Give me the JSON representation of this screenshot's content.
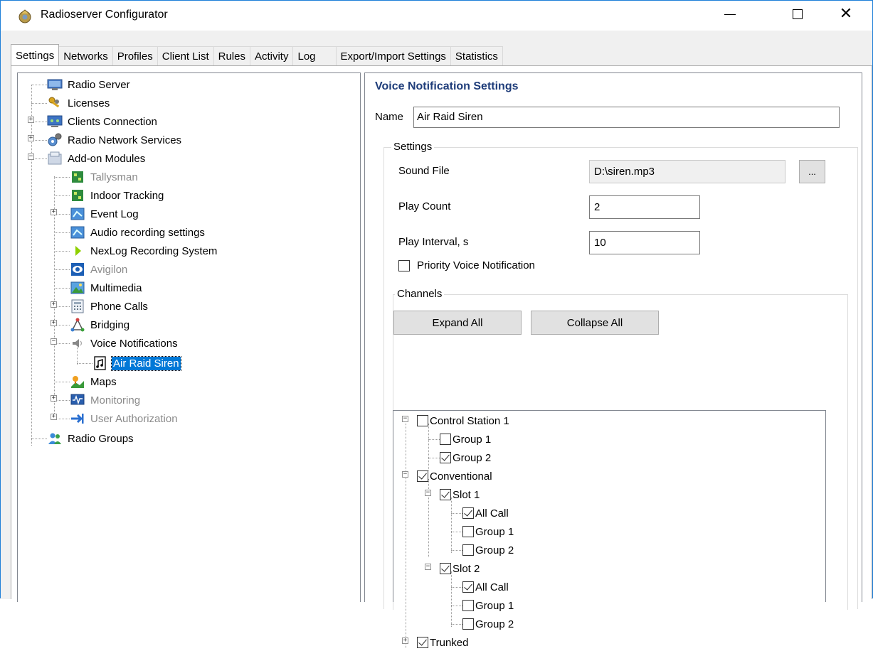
{
  "window": {
    "title": "Radioserver Configurator",
    "controls": {
      "minimize": "minimize",
      "maximize": "maximize",
      "close": "close"
    }
  },
  "tabs": [
    {
      "label": "Settings",
      "active": true
    },
    {
      "label": "Networks"
    },
    {
      "label": "Profiles"
    },
    {
      "label": "Client List"
    },
    {
      "label": "Rules"
    },
    {
      "label": "Activity"
    },
    {
      "label": "Log"
    },
    {
      "label": "Export/Import Settings"
    },
    {
      "label": "Statistics"
    }
  ],
  "tree": {
    "items": [
      {
        "label": "Radio Server",
        "icon": "server-icon"
      },
      {
        "label": "Licenses",
        "icon": "keys-icon"
      },
      {
        "label": "Clients Connection",
        "icon": "network-icon"
      },
      {
        "label": "Radio Network Services",
        "icon": "services-icon"
      },
      {
        "label": "Add-on Modules",
        "icon": "modules-icon"
      },
      {
        "label": "Tallysman",
        "icon": "module-icon"
      },
      {
        "label": "Indoor Tracking",
        "icon": "module-icon"
      },
      {
        "label": "Event Log",
        "icon": "event-log-icon"
      },
      {
        "label": "Audio recording settings",
        "icon": "audio-icon"
      },
      {
        "label": "NexLog Recording System",
        "icon": "play-icon"
      },
      {
        "label": "Avigilon",
        "icon": "eye-icon"
      },
      {
        "label": "Multimedia",
        "icon": "picture-icon"
      },
      {
        "label": "Phone Calls",
        "icon": "phone-icon"
      },
      {
        "label": "Bridging",
        "icon": "bridging-icon"
      },
      {
        "label": "Voice Notifications",
        "icon": "speaker-icon"
      },
      {
        "label": "Air Raid Siren",
        "icon": "music-file-icon"
      },
      {
        "label": "Maps",
        "icon": "map-icon"
      },
      {
        "label": "Monitoring",
        "icon": "monitoring-icon"
      },
      {
        "label": "User Authorization",
        "icon": "arrow-icon"
      },
      {
        "label": "Radio Groups",
        "icon": "groups-icon"
      }
    ]
  },
  "voice": {
    "title": "Voice Notification Settings",
    "name_label": "Name",
    "name_value": "Air Raid Siren",
    "settings_legend": "Settings",
    "sound_file_label": "Sound File",
    "sound_file_value": "D:\\siren.mp3",
    "browse_label": "...",
    "play_count_label": "Play Count",
    "play_count_value": "2",
    "play_interval_label": "Play Interval, s",
    "play_interval_value": "10",
    "priority_label": "Priority Voice Notification",
    "priority_checked": false,
    "channels_legend": "Channels",
    "expand_all": "Expand All",
    "collapse_all": "Collapse All"
  },
  "channels": [
    {
      "label": "Control Station 1",
      "checked": false
    },
    {
      "label": "Group 1",
      "checked": false
    },
    {
      "label": "Group 2",
      "checked": true
    },
    {
      "label": "Conventional",
      "checked": true
    },
    {
      "label": "Slot 1",
      "checked": true
    },
    {
      "label": "All Call",
      "checked": true
    },
    {
      "label": "Group 1",
      "checked": false
    },
    {
      "label": "Group 2",
      "checked": false
    },
    {
      "label": "Slot 2",
      "checked": true
    },
    {
      "label": "All Call",
      "checked": true
    },
    {
      "label": "Group 1",
      "checked": false
    },
    {
      "label": "Group 2",
      "checked": false
    },
    {
      "label": "Trunked",
      "checked": true
    }
  ]
}
